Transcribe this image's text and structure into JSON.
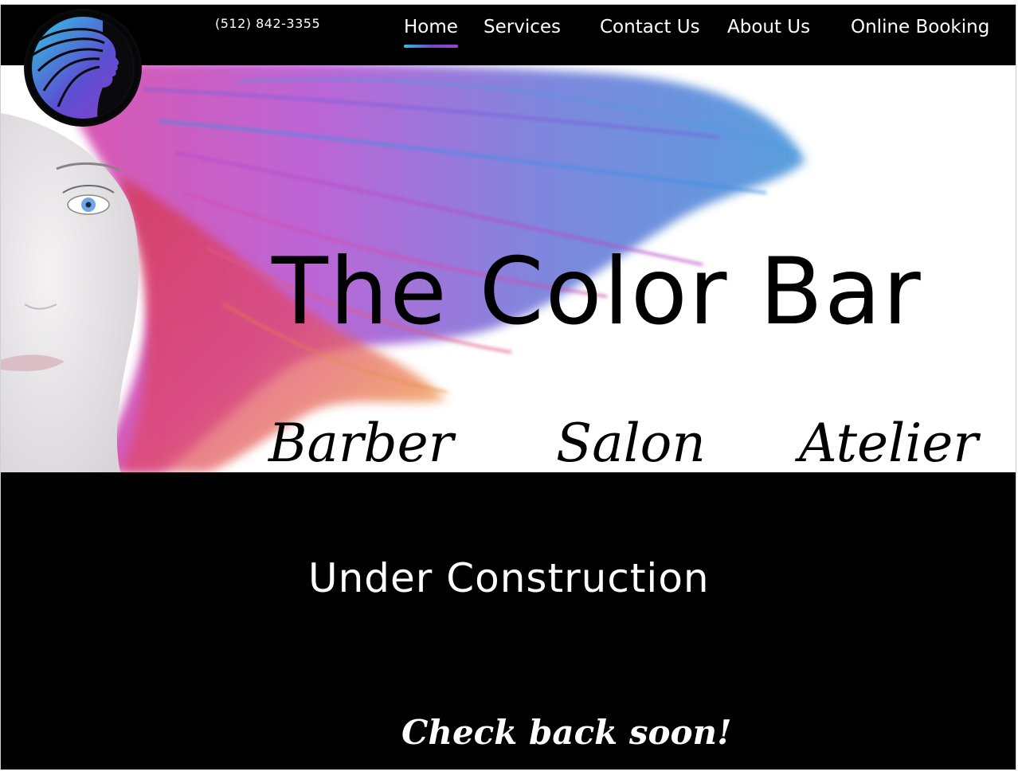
{
  "header": {
    "phone": "(512) 842-3355",
    "nav": [
      {
        "label": "Home",
        "active": true
      },
      {
        "label": "Services"
      },
      {
        "label": "Contact Us"
      },
      {
        "label": "About Us"
      },
      {
        "label": "Online Booking"
      }
    ]
  },
  "hero": {
    "title": "The Color Bar",
    "subtitles": [
      "Barber",
      "Salon",
      "Atelier"
    ]
  },
  "main": {
    "heading": "Under Construction",
    "tagline": "Check back soon!"
  },
  "colors": {
    "background": "#000000",
    "accent_gradient": [
      "#29c4d6",
      "#6d4bd1",
      "#a13fd0"
    ],
    "logo_gradient": [
      "#33c6e0",
      "#5b4fd2",
      "#8a3ec9"
    ]
  },
  "icons": {
    "logo": "woman-profile-flowing-hair-logo"
  }
}
